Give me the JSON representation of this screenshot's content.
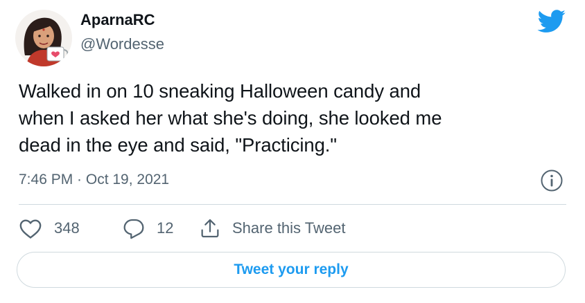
{
  "author": {
    "name": "AparnaRC",
    "handle": "@Wordesse"
  },
  "tweet": {
    "text_lines": [
      "Walked in on 10 sneaking Halloween candy and",
      "when I asked her what she's doing, she looked me",
      "dead in the eye and said, \"Practicing.\""
    ],
    "timestamp": "7:46 PM · Oct 19, 2021"
  },
  "actions": {
    "likes": "348",
    "replies": "12",
    "share_label": "Share this Tweet"
  },
  "reply_button": {
    "label": "Tweet your reply"
  },
  "icons": {
    "brand": "twitter-bird-icon",
    "info": "info-icon",
    "like": "heart-icon",
    "reply": "reply-bubble-icon",
    "share": "share-icon"
  },
  "colors": {
    "brand": "#1d9bf0",
    "text": "#0f1419",
    "muted": "#536471",
    "border": "#cfd9de"
  }
}
